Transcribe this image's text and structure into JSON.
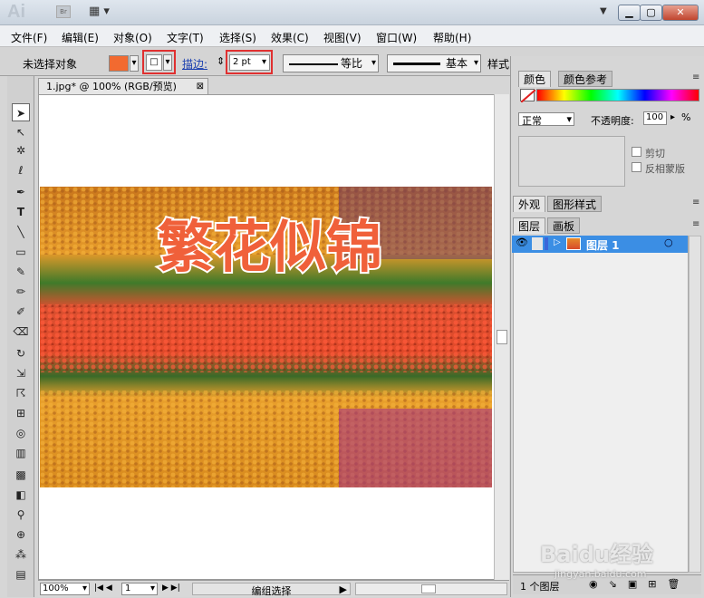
{
  "app": {
    "logo": "Ai",
    "bridge": "Br"
  },
  "menu": [
    "文件(F)",
    "编辑(E)",
    "对象(O)",
    "文字(T)",
    "选择(S)",
    "效果(C)",
    "视图(V)",
    "窗口(W)",
    "帮助(H)"
  ],
  "control": {
    "selection_status": "未选择对象",
    "fill_color": "#f26a30",
    "stroke_label": "描边:",
    "stroke_value": "2 pt",
    "profile_label": "等比",
    "brush_label": "基本",
    "style_label": "样式:"
  },
  "document": {
    "tab_title": "1.jpg* @ 100% (RGB/预览)",
    "artwork_text": "繁花似锦"
  },
  "status": {
    "zoom": "100%",
    "page": "1",
    "status_text": "编组选择"
  },
  "color_panel": {
    "tab_color": "颜色",
    "tab_guide": "颜色参考"
  },
  "transparency": {
    "mode": "正常",
    "opacity_label": "不透明度:",
    "opacity": "100",
    "unit": "%",
    "clip": "剪切",
    "invert": "反相蒙版"
  },
  "appearance_panel": {
    "tab_appearance": "外观",
    "tab_styles": "图形样式"
  },
  "layers_panel": {
    "tab_layers": "图层",
    "tab_artboards": "画板",
    "layer_name": "图层 1",
    "count": "1 个图层"
  },
  "watermark": {
    "brand": "Baidu经验",
    "url": "jingyan.baidu.com"
  }
}
